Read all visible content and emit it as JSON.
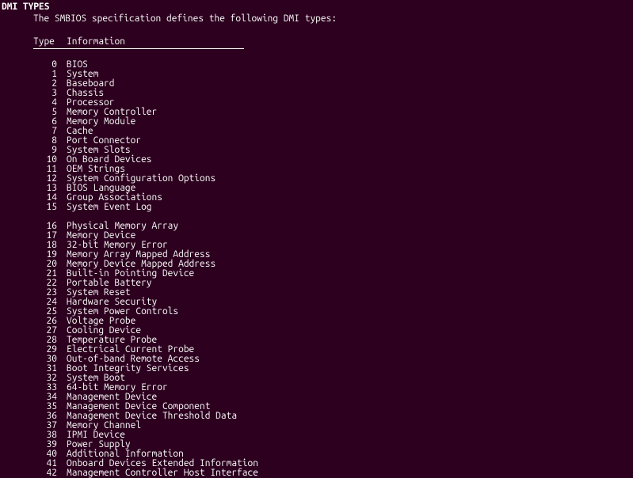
{
  "heading": "DMI TYPES",
  "intro": "The SMBIOS specification defines the following DMI types:",
  "headers": {
    "col1": "Type",
    "col2": "Information"
  },
  "group1": [
    {
      "type": "0",
      "info": "BIOS"
    },
    {
      "type": "1",
      "info": "System"
    },
    {
      "type": "2",
      "info": "Baseboard"
    },
    {
      "type": "3",
      "info": "Chassis"
    },
    {
      "type": "4",
      "info": "Processor"
    },
    {
      "type": "5",
      "info": "Memory Controller"
    },
    {
      "type": "6",
      "info": "Memory Module"
    },
    {
      "type": "7",
      "info": "Cache"
    },
    {
      "type": "8",
      "info": "Port Connector"
    },
    {
      "type": "9",
      "info": "System Slots"
    },
    {
      "type": "10",
      "info": "On Board Devices"
    },
    {
      "type": "11",
      "info": "OEM Strings"
    },
    {
      "type": "12",
      "info": "System Configuration Options"
    },
    {
      "type": "13",
      "info": "BIOS Language"
    },
    {
      "type": "14",
      "info": "Group Associations"
    },
    {
      "type": "15",
      "info": "System Event Log"
    }
  ],
  "group2": [
    {
      "type": "16",
      "info": "Physical Memory Array"
    },
    {
      "type": "17",
      "info": "Memory Device"
    },
    {
      "type": "18",
      "info": "32-bit Memory Error"
    },
    {
      "type": "19",
      "info": "Memory Array Mapped Address"
    },
    {
      "type": "20",
      "info": "Memory Device Mapped Address"
    },
    {
      "type": "21",
      "info": "Built-in Pointing Device"
    },
    {
      "type": "22",
      "info": "Portable Battery"
    },
    {
      "type": "23",
      "info": "System Reset"
    },
    {
      "type": "24",
      "info": "Hardware Security"
    },
    {
      "type": "25",
      "info": "System Power Controls"
    },
    {
      "type": "26",
      "info": "Voltage Probe"
    },
    {
      "type": "27",
      "info": "Cooling Device"
    },
    {
      "type": "28",
      "info": "Temperature Probe"
    },
    {
      "type": "29",
      "info": "Electrical Current Probe"
    },
    {
      "type": "30",
      "info": "Out-of-band Remote Access"
    },
    {
      "type": "31",
      "info": "Boot Integrity Services"
    },
    {
      "type": "32",
      "info": "System Boot"
    },
    {
      "type": "33",
      "info": "64-bit Memory Error"
    },
    {
      "type": "34",
      "info": "Management Device"
    },
    {
      "type": "35",
      "info": "Management Device Component"
    },
    {
      "type": "36",
      "info": "Management Device Threshold Data"
    },
    {
      "type": "37",
      "info": "Memory Channel"
    },
    {
      "type": "38",
      "info": "IPMI Device"
    },
    {
      "type": "39",
      "info": "Power Supply"
    },
    {
      "type": "40",
      "info": "Additional Information"
    },
    {
      "type": "41",
      "info": "Onboard Devices Extended Information"
    },
    {
      "type": "42",
      "info": "Management Controller Host Interface"
    }
  ]
}
